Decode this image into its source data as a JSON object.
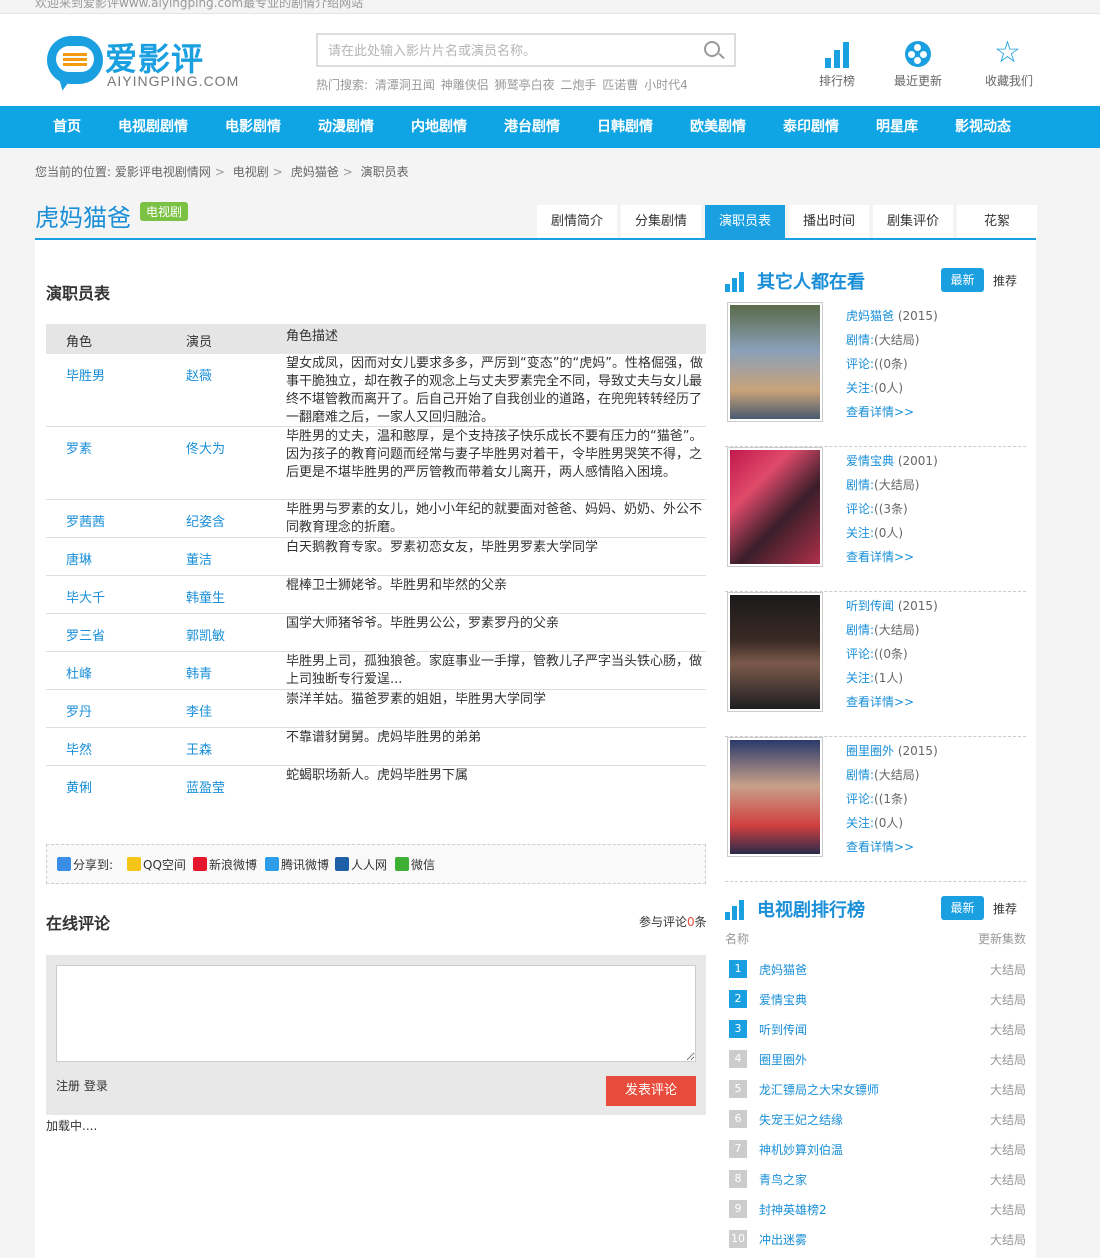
{
  "topbar": {
    "text": "欢迎来到爱影评www.aiyingping.com最专业的剧情介绍网站"
  },
  "logo": {
    "cn": "爱影评",
    "en": "AIYINGPING.COM"
  },
  "search": {
    "placeholder": "请在此处输入影片片名或演员名称。",
    "hot_label": "热门搜索:",
    "hot": [
      "清潭洞丑闻",
      "神雕侠侣",
      "狮鹫亭白夜",
      "二炮手",
      "匹诺曹",
      "小时代4"
    ]
  },
  "header_icons": [
    {
      "label": "排行榜",
      "icon": "bar-chart-icon"
    },
    {
      "label": "最近更新",
      "icon": "film-reel-icon"
    },
    {
      "label": "收藏我们",
      "icon": "star-icon"
    }
  ],
  "nav": [
    "首页",
    "电视剧剧情",
    "电影剧情",
    "动漫剧情",
    "内地剧情",
    "港台剧情",
    "日韩剧情",
    "欧美剧情",
    "泰印剧情",
    "明星库",
    "影视动态"
  ],
  "breadcrumb": {
    "prefix": "您当前的位置:",
    "items": [
      "爱影评电视剧情网",
      "电视剧",
      "虎妈猫爸",
      "演职员表"
    ]
  },
  "page": {
    "title": "虎妈猫爸",
    "badge": "电视剧"
  },
  "tabs": [
    "剧情简介",
    "分集剧情",
    "演职员表",
    "播出时间",
    "剧集评价",
    "花絮"
  ],
  "active_tab": "演职员表",
  "cast": {
    "title": "演职员表",
    "headers": [
      "角色",
      "演员",
      "角色描述"
    ],
    "rows": [
      {
        "role": "毕胜男",
        "actor": "赵薇",
        "desc": "望女成凤，因而对女儿要求多多，严厉到“变态”的“虎妈”。性格倔强，做事干脆独立，却在教子的观念上与丈夫罗素完全不同，导致丈夫与女儿最终不堪管教而离开了。后自己开始了自我创业的道路，在兜兜转转经历了一翻磨难之后，一家人又回归融洽。"
      },
      {
        "role": "罗素",
        "actor": "佟大为",
        "desc": "毕胜男的丈夫，温和憨厚，是个支持孩子快乐成长不要有压力的“猫爸”。因为孩子的教育问题而经常与妻子毕胜男对着干，令毕胜男哭笑不得，之后更是不堪毕胜男的严厉管教而带着女儿离开，两人感情陷入困境。"
      },
      {
        "role": "罗茜茜",
        "actor": "纪姿含",
        "desc": "毕胜男与罗素的女儿，她小小年纪的就要面对爸爸、妈妈、奶奶、外公不同教育理念的折磨。"
      },
      {
        "role": "唐琳",
        "actor": "董洁",
        "desc": "白天鹅教育专家。罗素初恋女友，毕胜男罗素大学同学"
      },
      {
        "role": "毕大千",
        "actor": "韩童生",
        "desc": "棍棒卫士狮姥爷。毕胜男和毕然的父亲"
      },
      {
        "role": "罗三省",
        "actor": "郭凯敏",
        "desc": "国学大师猪爷爷。毕胜男公公，罗素罗丹的父亲"
      },
      {
        "role": "杜峰",
        "actor": "韩青",
        "desc": "毕胜男上司，孤独狼爸。家庭事业一手撑，管教儿子严字当头铁心肠，做上司独断专行爱逞..."
      },
      {
        "role": "罗丹",
        "actor": "李佳",
        "desc": "崇洋羊姑。猫爸罗素的姐姐，毕胜男大学同学"
      },
      {
        "role": "毕然",
        "actor": "王森",
        "desc": "不靠谱豺舅舅。虎妈毕胜男的弟弟"
      },
      {
        "role": "黄俐",
        "actor": "蓝盈莹",
        "desc": "蛇蝎职场新人。虎妈毕胜男下属"
      }
    ]
  },
  "share": {
    "label": "分享到:",
    "items": [
      "QQ空间",
      "新浪微博",
      "腾讯微博",
      "人人网",
      "微信"
    ]
  },
  "comments": {
    "title": "在线评论",
    "count_prefix": "参与评论",
    "count": "0",
    "count_suffix": "条",
    "register": "注册",
    "login": "登录",
    "submit": "发表评论",
    "loading": "加载中...."
  },
  "others": {
    "title": "其它人都在看",
    "new": "最新",
    "rec": "推荐",
    "label_plot": "剧情:",
    "label_review": "评论:",
    "label_follow": "关注:",
    "more": "查看详情>>",
    "items": [
      {
        "title": "虎妈猫爸",
        "year": "(2015)",
        "plot": "(大结局)",
        "review": "((0条)",
        "follow": "(0人)"
      },
      {
        "title": "爱情宝典",
        "year": "(2001)",
        "plot": "(大结局)",
        "review": "((3条)",
        "follow": "(0人)"
      },
      {
        "title": "听到传闻",
        "year": "(2015)",
        "plot": "(大结局)",
        "review": "((0条)",
        "follow": "(1人)"
      },
      {
        "title": "圈里圈外",
        "year": "(2015)",
        "plot": "(大结局)",
        "review": "((1条)",
        "follow": "(0人)"
      }
    ]
  },
  "ranking": {
    "title": "电视剧排行榜",
    "new": "最新",
    "rec": "推荐",
    "col_name": "名称",
    "col_eps": "更新集数",
    "items": [
      {
        "n": "1",
        "name": "虎妈猫爸",
        "status": "大结局"
      },
      {
        "n": "2",
        "name": "爱情宝典",
        "status": "大结局"
      },
      {
        "n": "3",
        "name": "听到传闻",
        "status": "大结局"
      },
      {
        "n": "4",
        "name": "圈里圈外",
        "status": "大结局"
      },
      {
        "n": "5",
        "name": "龙汇镖局之大宋女镖师",
        "status": "大结局"
      },
      {
        "n": "6",
        "name": "失宠王妃之结缘",
        "status": "大结局"
      },
      {
        "n": "7",
        "name": "神机妙算刘伯温",
        "status": "大结局"
      },
      {
        "n": "8",
        "name": "青鸟之家",
        "status": "大结局"
      },
      {
        "n": "9",
        "name": "封神英雄榜2",
        "status": "大结局"
      },
      {
        "n": "10",
        "name": "冲出迷雾",
        "status": "大结局"
      }
    ]
  },
  "colors": {
    "brand": "#1a9fe0",
    "nav": "#0fa4e3",
    "badge": "#7bc144",
    "submit": "#e74c3c"
  }
}
